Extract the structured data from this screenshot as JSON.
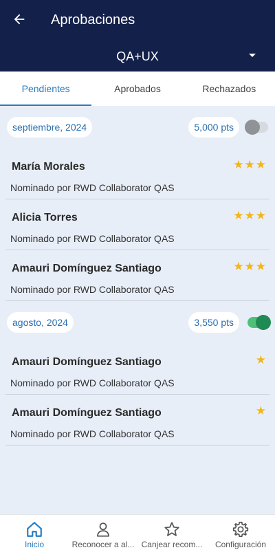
{
  "header": {
    "title": "Aprobaciones",
    "group": "QA+UX"
  },
  "tabs": [
    {
      "label": "Pendientes",
      "active": true
    },
    {
      "label": "Aprobados",
      "active": false
    },
    {
      "label": "Rechazados",
      "active": false
    }
  ],
  "sections": [
    {
      "period": "septiembre, 2024",
      "points": "5,000 pts",
      "toggle_on": false,
      "items": [
        {
          "name": "María Morales",
          "nominated_by": "Nominado por RWD Collaborator QAS",
          "stars": "★★★"
        },
        {
          "name": "Alicia Torres",
          "nominated_by": "Nominado por RWD Collaborator QAS",
          "stars": "★★★"
        },
        {
          "name": "Amauri Domínguez Santiago",
          "nominated_by": "Nominado por RWD Collaborator QAS",
          "stars": "★★★"
        }
      ]
    },
    {
      "period": "agosto, 2024",
      "points": "3,550 pts",
      "toggle_on": true,
      "items": [
        {
          "name": "Amauri Domínguez Santiago",
          "nominated_by": "Nominado por RWD Collaborator QAS",
          "stars": "★"
        },
        {
          "name": "Amauri Domínguez Santiago",
          "nominated_by": "Nominado por RWD Collaborator QAS",
          "stars": "★"
        }
      ]
    }
  ],
  "bottom_nav": [
    {
      "label": "Inicio",
      "icon": "home-icon",
      "active": true
    },
    {
      "label": "Reconocer a al...",
      "icon": "person-icon",
      "active": false
    },
    {
      "label": "Canjear recom...",
      "icon": "star-icon",
      "active": false
    },
    {
      "label": "Configuración",
      "icon": "gear-icon",
      "active": false
    }
  ],
  "colors": {
    "header_bg": "#13204a",
    "accent": "#2a7bbf",
    "star": "#f2b617",
    "toggle_on": "#1f8a54"
  }
}
